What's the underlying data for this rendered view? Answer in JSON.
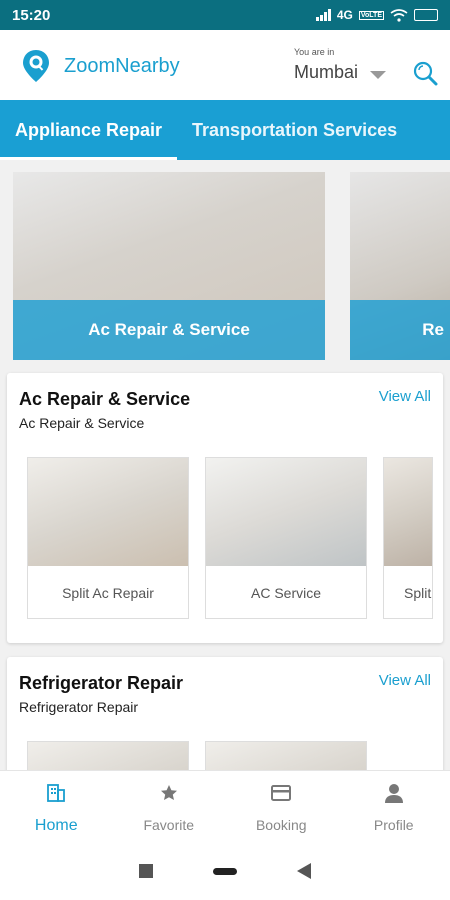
{
  "status_bar": {
    "time": "15:20",
    "network": "4G",
    "volte_badge": "VoLTE"
  },
  "header": {
    "brand": "ZoomNearby",
    "location_caption": "You are in",
    "city": "Mumbai"
  },
  "tabs": [
    {
      "label": "Appliance Repair",
      "active": true
    },
    {
      "label": "Transportation Services",
      "active": false
    }
  ],
  "banners": [
    {
      "caption": "Ac Repair & Service"
    },
    {
      "caption": "Re"
    }
  ],
  "sections": [
    {
      "title": "Ac Repair & Service",
      "subtitle": "Ac Repair & Service",
      "view_all": "View All",
      "items": [
        {
          "label": "Split Ac Repair"
        },
        {
          "label": "AC Service"
        },
        {
          "label": "Split"
        }
      ]
    },
    {
      "title": "Refrigerator Repair",
      "subtitle": "Refrigerator Repair",
      "view_all": "View All",
      "items": [
        {
          "label": ""
        },
        {
          "label": ""
        }
      ]
    }
  ],
  "bottom_nav": [
    {
      "label": "Home",
      "icon": "building-icon",
      "active": true
    },
    {
      "label": "Favorite",
      "icon": "star-icon",
      "active": false
    },
    {
      "label": "Booking",
      "icon": "card-icon",
      "active": false
    },
    {
      "label": "Profile",
      "icon": "person-icon",
      "active": false
    }
  ],
  "colors": {
    "accent": "#1a9fd3",
    "status_bar": "#0b6f80",
    "link": "#1a9fcf"
  }
}
